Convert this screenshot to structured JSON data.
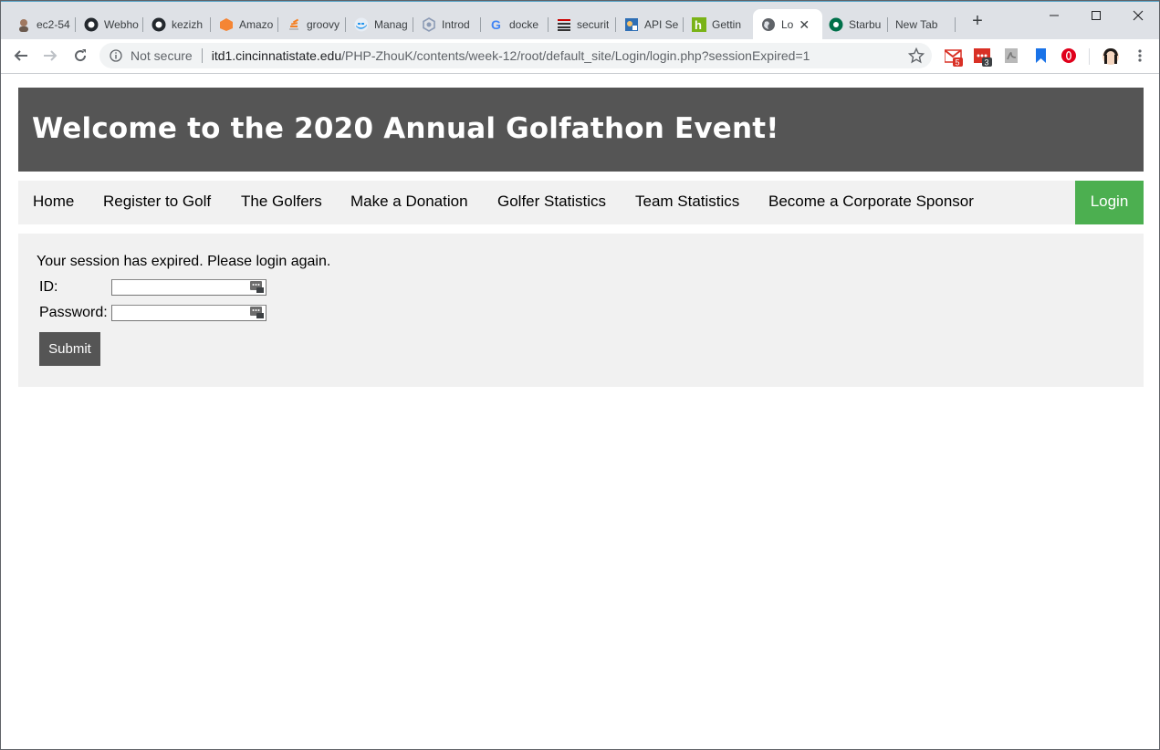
{
  "browser": {
    "tabs": [
      {
        "title": "ec2-54",
        "icon": "person-avatar-icon"
      },
      {
        "title": "Webho",
        "icon": "github-icon"
      },
      {
        "title": "kezizh",
        "icon": "github-icon"
      },
      {
        "title": "Amazo",
        "icon": "aws-cube-icon"
      },
      {
        "title": "groovy",
        "icon": "stackoverflow-icon"
      },
      {
        "title": "Manag",
        "icon": "docker-icon"
      },
      {
        "title": "Introd",
        "icon": "hexagon-icon"
      },
      {
        "title": "docke",
        "icon": "google-icon"
      },
      {
        "title": "securit",
        "icon": "bars-icon"
      },
      {
        "title": "API Se",
        "icon": "api-icon"
      },
      {
        "title": "Gettin",
        "icon": "h-logo-icon"
      },
      {
        "title": "Lo",
        "icon": "globe-icon",
        "active": true
      },
      {
        "title": "Starbu",
        "icon": "starbucks-icon"
      },
      {
        "title": "New Tab",
        "icon": ""
      }
    ],
    "new_tab_label": "+",
    "omnibox": {
      "security": "Not secure",
      "host": "itd1.cincinnatistate.edu",
      "path": "/PHP-ZhouK/contents/week-12/root/default_site/Login/login.php?sessionExpired=1"
    },
    "extensions": {
      "gmail_badge": "5",
      "calendar_badge": "3"
    }
  },
  "page": {
    "header_title": "Welcome to the 2020 Annual Golfathon Event!",
    "nav": [
      "Home",
      "Register to Golf",
      "The Golfers",
      "Make a Donation",
      "Golfer Statistics",
      "Team Statistics",
      "Become a Corporate Sponsor"
    ],
    "login_label": "Login",
    "form": {
      "message": "Your session has expired. Please login again.",
      "id_label": "ID:",
      "password_label": "Password:",
      "id_value": "",
      "password_value": "",
      "submit_label": "Submit"
    }
  },
  "colors": {
    "header_bg": "#555555",
    "nav_bg": "#f1f1f1",
    "login_bg": "#4caf50",
    "submit_bg": "#555555"
  }
}
